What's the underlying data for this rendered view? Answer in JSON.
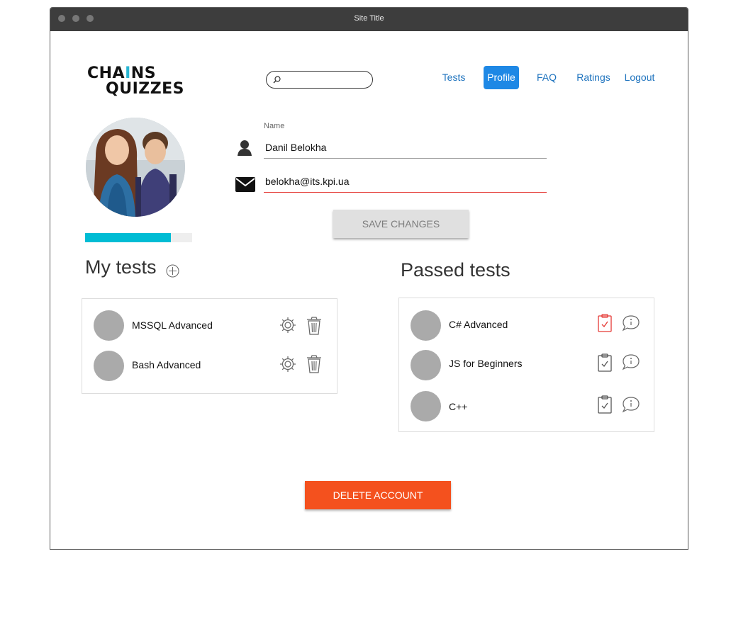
{
  "window": {
    "title": "Site Title"
  },
  "header": {
    "logo_line1_a": "CHA",
    "logo_line1_b": "I",
    "logo_line1_c": "NS",
    "logo_line2": "QUIZZES",
    "search": {
      "value": "",
      "placeholder": ""
    },
    "nav": {
      "tests": "Tests",
      "profile": "Profile",
      "faq": "FAQ",
      "ratings": "Ratings",
      "logout": "Logout"
    },
    "active_tab": "Profile"
  },
  "profile": {
    "name_label": "Name",
    "name_value": "Danil Belokha",
    "email_value": "belokha@its.kpi.ua",
    "progress_fraction": 0.8,
    "save_label": "SAVE CHANGES"
  },
  "my_tests": {
    "title": "My tests",
    "items": [
      {
        "name": "MSSQL Advanced"
      },
      {
        "name": "Bash Advanced"
      }
    ]
  },
  "passed_tests": {
    "title": "Passed tests",
    "items": [
      {
        "name": "C# Advanced",
        "highlighted": true
      },
      {
        "name": "JS for Beginners",
        "highlighted": false
      },
      {
        "name": "C++",
        "highlighted": false
      }
    ]
  },
  "delete_label": "DELETE ACCOUNT",
  "colors": {
    "accent_blue": "#1e88e5",
    "progress": "#00bcd4",
    "danger": "#f4511e",
    "logo_accent": "#29b6d2"
  }
}
